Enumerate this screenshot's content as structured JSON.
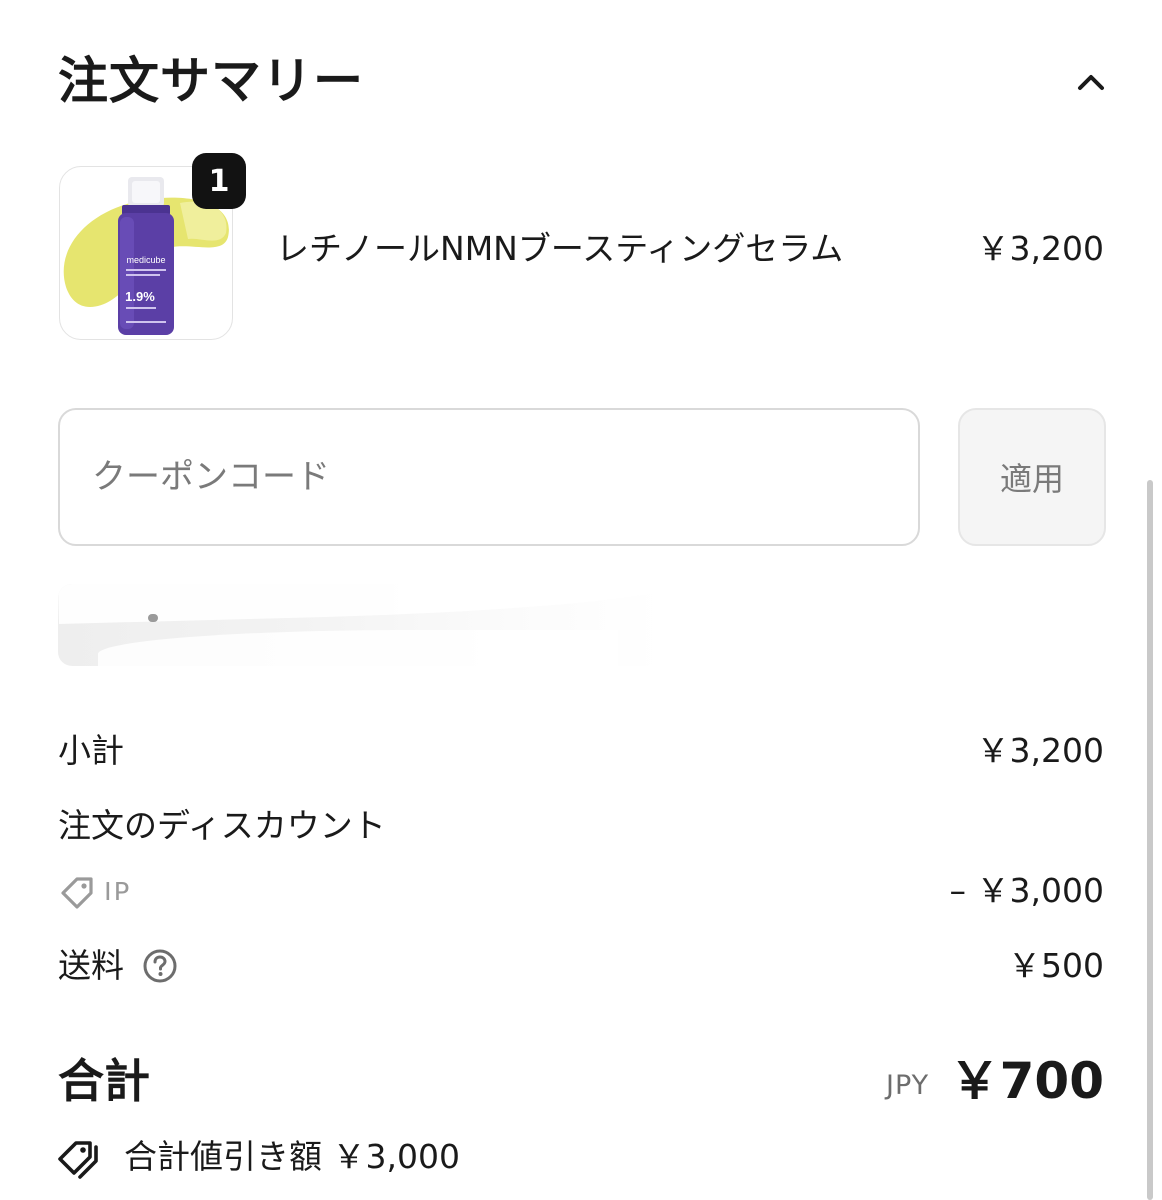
{
  "header": {
    "title": "注文サマリー",
    "collapse_icon": "chevron-up-icon"
  },
  "product": {
    "name": "レチノールNMNブースティングセラム",
    "price": "￥3,200",
    "quantity": "1",
    "image_icon": "serum-bottle-image",
    "brand_label": "medicube",
    "bottle_text": "1.9%"
  },
  "coupon": {
    "placeholder": "クーポンコード",
    "value": "",
    "apply_label": "適用"
  },
  "summary": {
    "subtotal_label": "小計",
    "subtotal_value": "￥3,200",
    "discount_label": "注文のディスカウント",
    "discount_code": "JP",
    "discount_icon": "tag-icon",
    "discount_value": "– ￥3,000",
    "shipping_label": "送料",
    "shipping_help_icon": "question-circle-icon",
    "shipping_value": "￥500"
  },
  "total": {
    "label": "合計",
    "currency": "JPY",
    "value": "￥700",
    "savings_icon": "tags-icon",
    "savings_text": "合計値引き額 ￥3,000"
  },
  "colors": {
    "text": "#1a1a1a",
    "muted": "#7a7a7a",
    "badge": "#121212",
    "border": "#d9d9d9",
    "bottle_purple": "#5b3fa6",
    "cream_yellow": "#e4e36a"
  }
}
